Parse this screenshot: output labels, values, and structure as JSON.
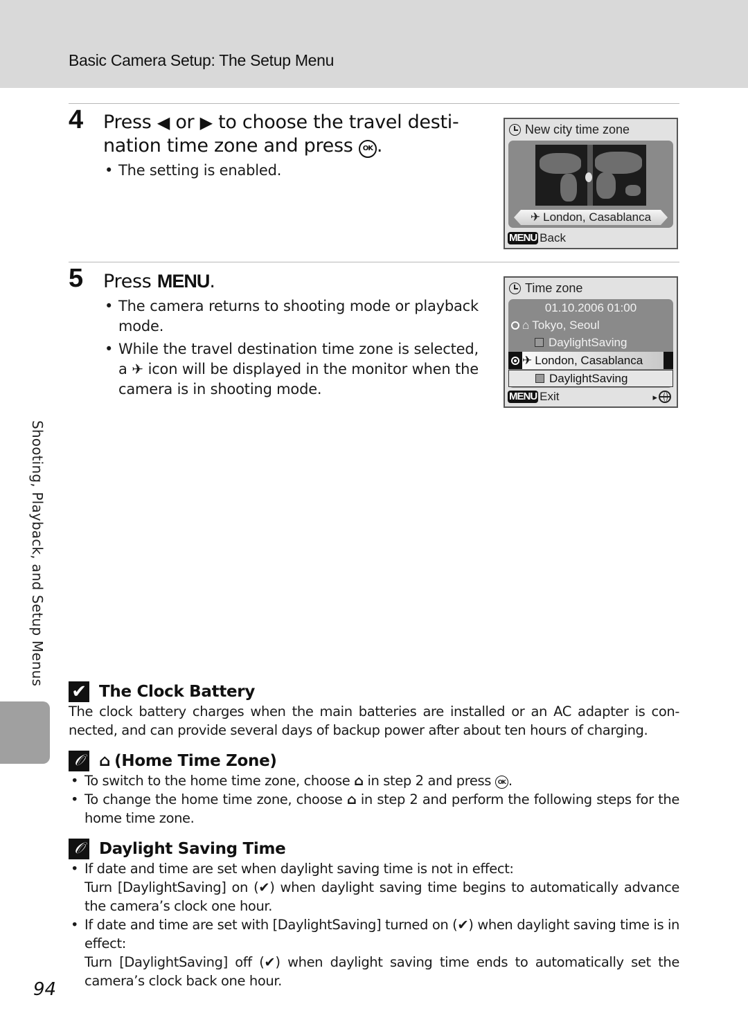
{
  "header": {
    "title": "Basic Camera Setup: The Setup Menu"
  },
  "step4": {
    "number": "4",
    "title_press": "Press",
    "left_arrow_glyph": "◀",
    "or": "or",
    "right_arrow_glyph": "▶",
    "title_rest_line1": "to choose the travel desti-",
    "title_line2": "nation time zone and press",
    "ok_glyph": "OK",
    "period": ".",
    "bullets": [
      "The setting is enabled."
    ]
  },
  "step5": {
    "number": "5",
    "title_press": "Press",
    "menu_glyph": "MENU",
    "period": ".",
    "bullet1": "The camera returns to shooting mode or playback mode.",
    "bullet2_pre": "While the travel destination time zone is selected, a",
    "plane_glyph": "✈",
    "bullet2_post": "icon will be displayed in the monitor when the camera is in shooting mode."
  },
  "screen1": {
    "title": "New city time zone",
    "city": "London, Casablanca",
    "plane_glyph": "✈",
    "menu_badge": "MENU",
    "footer": "Back"
  },
  "screen2": {
    "title": "Time zone",
    "datetime": "01.10.2006 01:00",
    "home_glyph": "⌂",
    "home_city": "Tokyo, Seoul",
    "daylight_label_1": "DaylightSaving",
    "plane_glyph": "✈",
    "travel_city": "London, Casablanca",
    "daylight_label_2": "DaylightSaving",
    "menu_badge": "MENU",
    "footer": "Exit",
    "footer_arrow": "▸"
  },
  "side": {
    "label": "Shooting, Playback, and Setup Menus"
  },
  "clock_battery": {
    "icon": "✔",
    "title": "The Clock Battery",
    "body": "The clock battery charges when the main batteries are installed or an AC adapter is con-nected, and can provide several days of backup power after about ten hours of charging."
  },
  "home_time_zone": {
    "icon": "𝒪",
    "home_glyph": "⌂",
    "title": "(Home Time Zone)",
    "bullet1_pre": "To switch to the home time zone, choose",
    "bullet1_mid": "in step 2 and press",
    "bullet1_ok": "OK",
    "bullet1_end": ".",
    "bullet2_pre": "To change the home time zone, choose",
    "bullet2_post": "in step 2 and perform the following steps for the home time zone."
  },
  "daylight_saving": {
    "icon": "𝒪",
    "title": "Daylight Saving Time",
    "bullet1_line1": "If date and time are set when daylight saving time is not in effect:",
    "bullet1_line2": "Turn [DaylightSaving] on (✔) when daylight saving time begins to automatically advance the camera’s clock one hour.",
    "bullet2_line1": "If date and time are set with [DaylightSaving] turned on (✔) when daylight saving time is in effect:",
    "bullet2_line2": "Turn [DaylightSaving] off (✔) when daylight saving time ends to automatically set the camera’s clock back one hour."
  },
  "page_number": "94"
}
